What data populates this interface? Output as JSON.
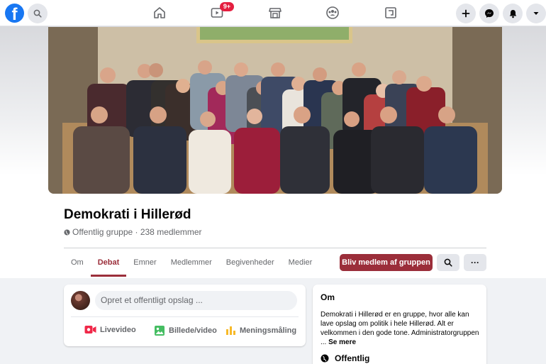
{
  "nav": {
    "logo_letter": "f",
    "watch_badge": "9+"
  },
  "group": {
    "name": "Demokrati i Hillerød",
    "meta": "Offentlig gruppe · 238 medlemmer"
  },
  "tabs": [
    {
      "label": "Om"
    },
    {
      "label": "Debat"
    },
    {
      "label": "Emner"
    },
    {
      "label": "Medlemmer"
    },
    {
      "label": "Begivenheder"
    },
    {
      "label": "Medier"
    }
  ],
  "actions": {
    "join_label": "Bliv medlem af gruppen",
    "more_label": "···"
  },
  "composer": {
    "placeholder": "Opret et offentligt opslag ...",
    "live_label": "Livevideo",
    "photo_label": "Billede/video",
    "poll_label": "Meningsmåling"
  },
  "about": {
    "title": "Om",
    "description": "Demokrati i Hillerød er en gruppe, hvor alle kan lave opslag om politik i hele Hillerød. Alt er velkommen i den gode tone. Administratorgruppen ...",
    "see_more": "Se mere",
    "visibility": "Offentlig"
  },
  "colors": {
    "brand": "#1877f2",
    "accent": "#9b2e3a",
    "notification": "#e41e3f"
  }
}
